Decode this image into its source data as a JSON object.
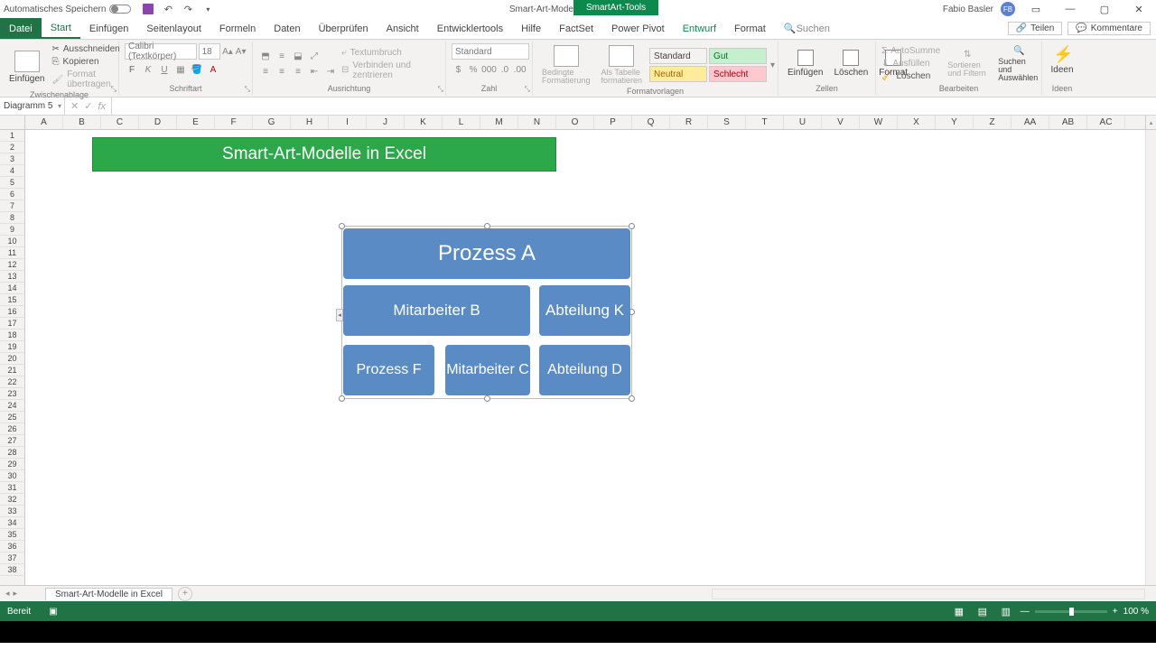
{
  "titlebar": {
    "autosave": "Automatisches Speichern",
    "doc_title": "Smart-Art-Modelle in Excel - Excel",
    "context_tab": "SmartArt-Tools",
    "user": "Fabio Basler",
    "user_initials": "FB"
  },
  "tabs": {
    "file": "Datei",
    "items": [
      "Start",
      "Einfügen",
      "Seitenlayout",
      "Formeln",
      "Daten",
      "Überprüfen",
      "Ansicht",
      "Entwicklertools",
      "Hilfe",
      "FactSet",
      "Power Pivot",
      "Entwurf",
      "Format"
    ],
    "active": "Start",
    "context": "Entwurf",
    "search": "Suchen",
    "share": "Teilen",
    "comments": "Kommentare"
  },
  "ribbon": {
    "clipboard": {
      "paste": "Einfügen",
      "cut": "Ausschneiden",
      "copy": "Kopieren",
      "format_painter": "Format übertragen",
      "label": "Zwischenablage"
    },
    "font": {
      "name": "Calibri (Textkörper)",
      "size": "18",
      "label": "Schriftart"
    },
    "align": {
      "wrap": "Textumbruch",
      "merge": "Verbinden und zentrieren",
      "label": "Ausrichtung"
    },
    "number": {
      "format": "Standard",
      "label": "Zahl"
    },
    "styles": {
      "cond": "Bedingte Formatierung",
      "table": "Als Tabelle formatieren",
      "s1": "Standard",
      "s2": "Gut",
      "s3": "Neutral",
      "s4": "Schlecht",
      "label": "Formatvorlagen"
    },
    "cells": {
      "insert": "Einfügen",
      "delete": "Löschen",
      "format": "Format",
      "label": "Zellen"
    },
    "editing": {
      "sum": "AutoSumme",
      "fill": "Ausfüllen",
      "clear": "Löschen",
      "sort": "Sortieren und Filtern",
      "find": "Suchen und Auswählen",
      "label": "Bearbeiten"
    },
    "ideas": {
      "btn": "Ideen",
      "label": "Ideen"
    }
  },
  "namebox": "Diagramm 5",
  "columns": [
    "A",
    "B",
    "C",
    "D",
    "E",
    "F",
    "G",
    "H",
    "I",
    "J",
    "K",
    "L",
    "M",
    "N",
    "O",
    "P",
    "Q",
    "R",
    "S",
    "T",
    "U",
    "V",
    "W",
    "X",
    "Y",
    "Z",
    "AA",
    "AB",
    "AC"
  ],
  "rows": 38,
  "banner": "Smart-Art-Modelle in Excel",
  "smartart": {
    "top": "Prozess A",
    "mid1": "Mitarbeiter B",
    "mid2": "Abteilung K",
    "bot1": "Prozess F",
    "bot2": "Mitarbeiter C",
    "bot3": "Abteilung D"
  },
  "sheet": "Smart-Art-Modelle in Excel",
  "status": {
    "ready": "Bereit",
    "zoom": "100 %"
  }
}
